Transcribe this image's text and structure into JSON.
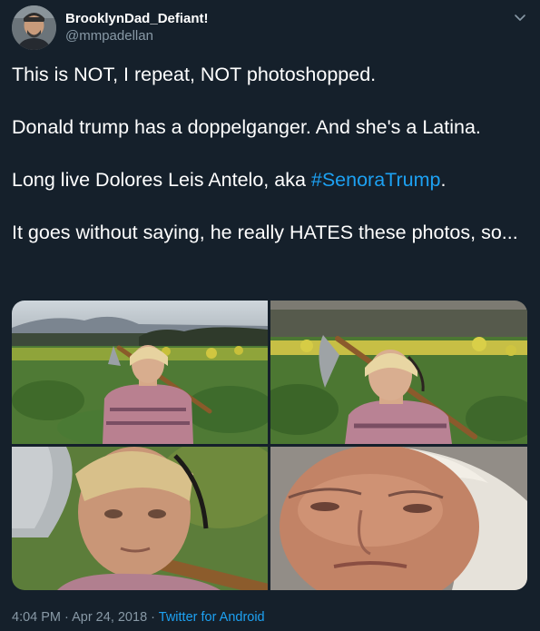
{
  "author": {
    "display_name": "BrooklynDad_Defiant!",
    "handle": "@mmpadellan",
    "avatar_icon": "profile-avatar"
  },
  "menu": {
    "icon": "chevron-down-icon"
  },
  "tweet": {
    "line1": "This is NOT, I repeat, NOT photoshopped.",
    "line2": "Donald trump has a doppelganger. And she's a Latina.",
    "line3_prefix": "Long live Dolores Leis Antelo, aka ",
    "hashtag": "#SenoraTrump",
    "line3_suffix": ".",
    "line4": "It goes without saying, he really HATES these photos, so..."
  },
  "media": {
    "photos": [
      {
        "subject": "woman with hoe in field, wide shot"
      },
      {
        "subject": "woman with hoe in field, closer shot"
      },
      {
        "subject": "woman face close-up"
      },
      {
        "subject": "man face close-up"
      }
    ]
  },
  "meta": {
    "time": "4:04 PM",
    "separator1": " · ",
    "date": "Apr 24, 2018",
    "separator2": " · ",
    "source": "Twitter for Android"
  },
  "colors": {
    "background": "#15202b",
    "text": "#ffffff",
    "muted": "#8899a6",
    "accent": "#1da1f2"
  }
}
